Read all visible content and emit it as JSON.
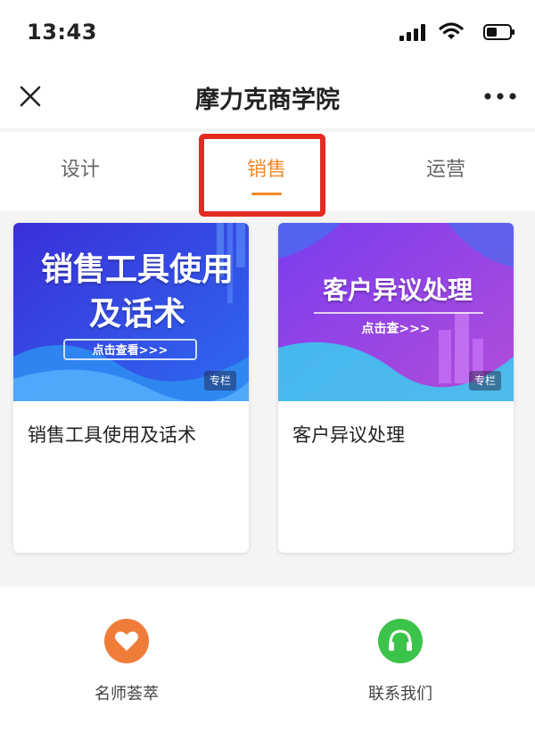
{
  "status_bar": {
    "time": "13:43"
  },
  "nav": {
    "title": "摩力克商学院"
  },
  "tabs": [
    {
      "label": "设计",
      "active": false
    },
    {
      "label": "销售",
      "active": true
    },
    {
      "label": "运营",
      "active": false
    }
  ],
  "colors": {
    "accent": "#f08a2a",
    "highlight": "#e32b21",
    "teacher_icon_bg": "#f07c3a",
    "contact_icon_bg": "#3cc44a"
  },
  "cards": [
    {
      "banner_title": "销售工具使用及话术",
      "banner_cta": "点击查看>>>",
      "badge": "专栏",
      "title": "销售工具使用及话术"
    },
    {
      "banner_title": "客户异议处理",
      "banner_cta": "点击查>>>",
      "badge": "专栏",
      "title": "客户异议处理"
    }
  ],
  "bottom": [
    {
      "label": "名师荟萃",
      "icon": "heart-icon"
    },
    {
      "label": "联系我们",
      "icon": "headphones-icon"
    }
  ]
}
